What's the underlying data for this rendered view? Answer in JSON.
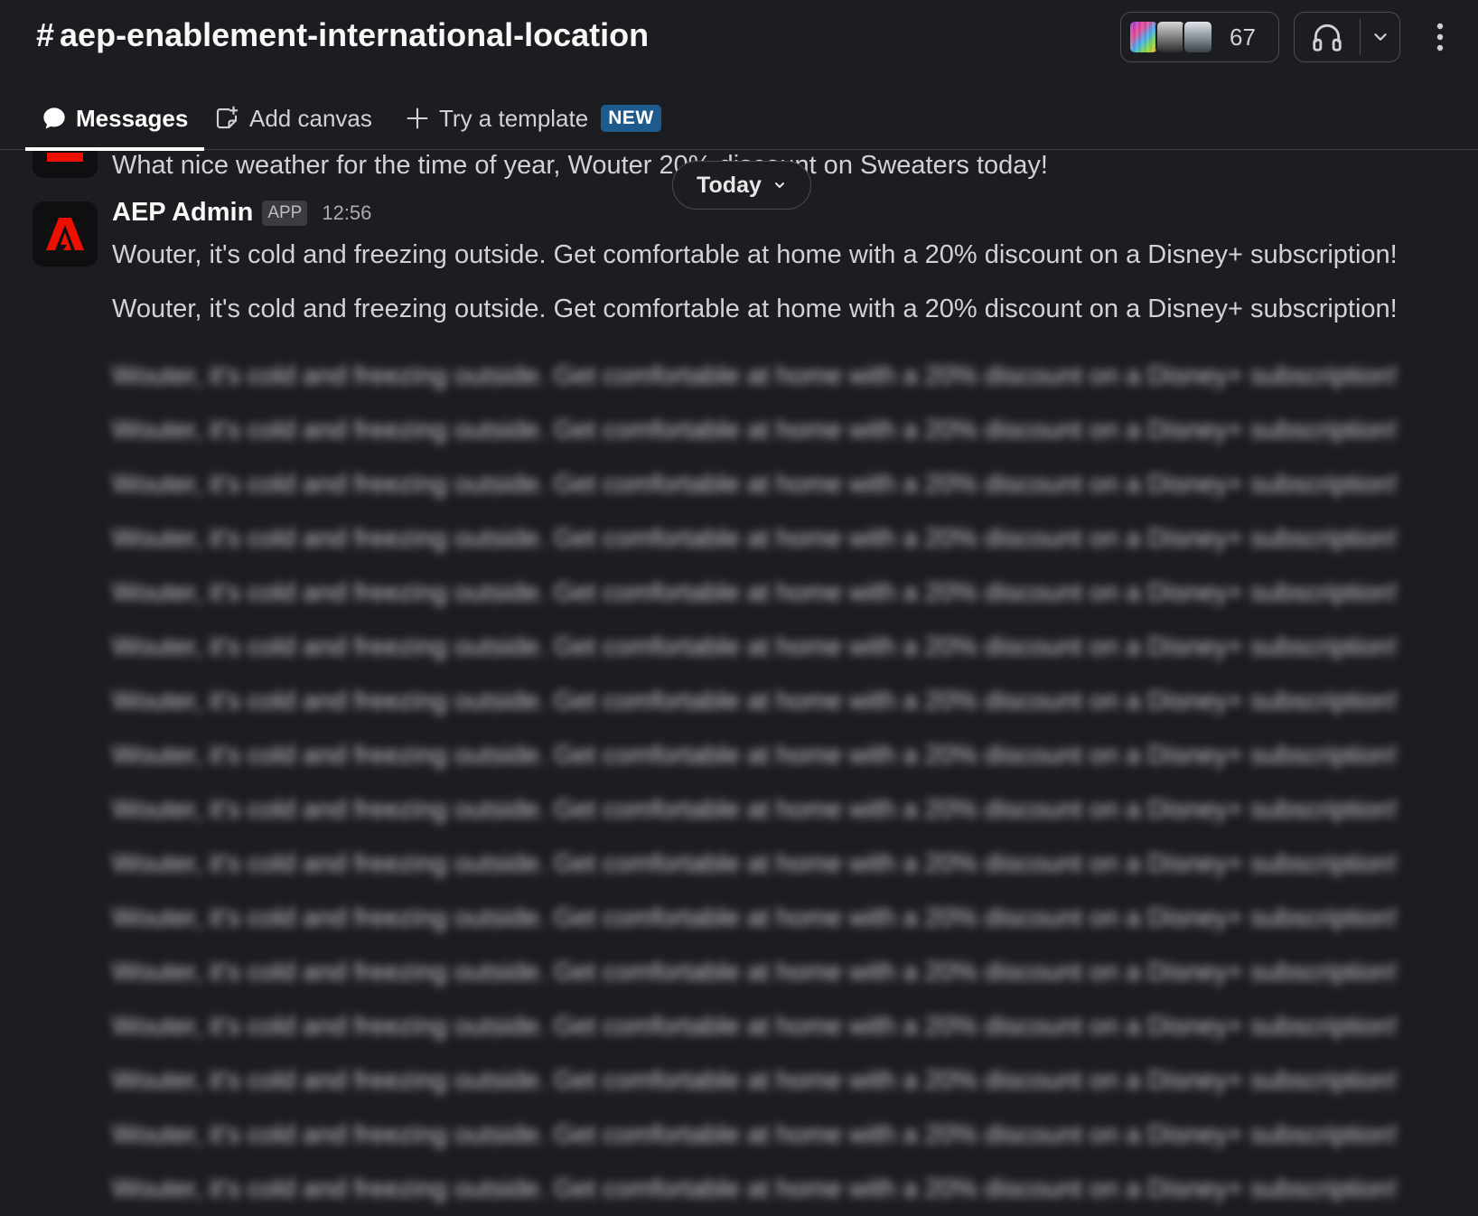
{
  "header": {
    "channel_name": "aep-enablement-international-location",
    "member_count": "67",
    "icons": {
      "hash": "hash-icon",
      "huddle": "headphones-icon",
      "huddle_menu": "chevron-down-icon",
      "more": "kebab-icon"
    }
  },
  "tabs": {
    "messages": "Messages",
    "add_canvas": "Add canvas",
    "try_template": "Try a template",
    "new_badge": "NEW"
  },
  "date_divider": {
    "label": "Today"
  },
  "previous_message": {
    "text": "What nice weather for the time of year, Wouter 20% discount on Sweaters today!"
  },
  "message": {
    "sender": "AEP Admin",
    "badge": "APP",
    "time": "12:56",
    "lines": [
      "Wouter, it's cold and freezing outside. Get comfortable at home with a 20% discount on a Disney+ subscription!",
      "Wouter, it's cold and freezing outside. Get comfortable at home with a 20% discount on a Disney+ subscription!"
    ],
    "blurred_lines": [
      "Wouter, it's cold and freezing outside. Get comfortable at home with a 20% discount on a Disney+ subscription!",
      "Wouter, it's cold and freezing outside. Get comfortable at home with a 20% discount on a Disney+ subscription!",
      "Wouter, it's cold and freezing outside. Get comfortable at home with a 20% discount on a Disney+ subscription!",
      "Wouter, it's cold and freezing outside. Get comfortable at home with a 20% discount on a Disney+ subscription!",
      "Wouter, it's cold and freezing outside. Get comfortable at home with a 20% discount on a Disney+ subscription!",
      "Wouter, it's cold and freezing outside. Get comfortable at home with a 20% discount on a Disney+ subscription!",
      "Wouter, it's cold and freezing outside. Get comfortable at home with a 20% discount on a Disney+ subscription!",
      "Wouter, it's cold and freezing outside. Get comfortable at home with a 20% discount on a Disney+ subscription!",
      "Wouter, it's cold and freezing outside. Get comfortable at home with a 20% discount on a Disney+ subscription!",
      "Wouter, it's cold and freezing outside. Get comfortable at home with a 20% discount on a Disney+ subscription!",
      "Wouter, it's cold and freezing outside. Get comfortable at home with a 20% discount on a Disney+ subscription!",
      "Wouter, it's cold and freezing outside. Get comfortable at home with a 20% discount on a Disney+ subscription!",
      "Wouter, it's cold and freezing outside. Get comfortable at home with a 20% discount on a Disney+ subscription!",
      "Wouter, it's cold and freezing outside. Get comfortable at home with a 20% discount on a Disney+ subscription!",
      "Wouter, it's cold and freezing outside. Get comfortable at home with a 20% discount on a Disney+ subscription!",
      "Wouter, it's cold and freezing outside. Get comfortable at home with a 20% discount on a Disney+ subscription!"
    ]
  },
  "colors": {
    "background": "#1b1d21",
    "text": "#d1d2d3",
    "adobe_red": "#eb1000",
    "new_badge": "#1d5a8e"
  }
}
